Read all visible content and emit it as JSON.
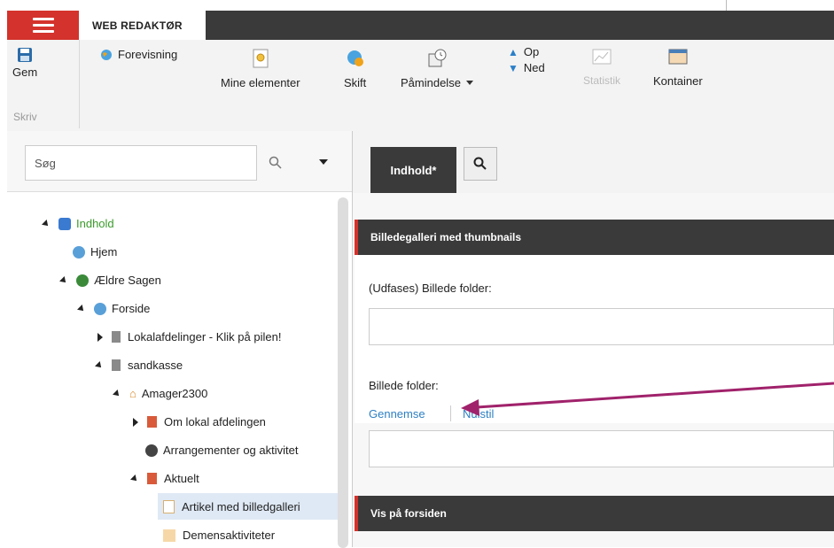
{
  "topbar": {
    "tab_label": "WEB REDAKTØR"
  },
  "ribbon": {
    "save_label": "Gem",
    "write_label": "Skriv",
    "preview_label": "Forevisning",
    "my_elements_label": "Mine elementer",
    "switch_label": "Skift",
    "reminder_label": "Påmindelse",
    "up_label": "Op",
    "down_label": "Ned",
    "statistics_label": "Statistik",
    "container_label": "Kontainer"
  },
  "search": {
    "placeholder": "Søg"
  },
  "tree": {
    "items": [
      {
        "label": "Indhold"
      },
      {
        "label": "Hjem"
      },
      {
        "label": "Ældre Sagen"
      },
      {
        "label": "Forside"
      },
      {
        "label": "Lokalafdelinger - Klik på pilen!"
      },
      {
        "label": "sandkasse"
      },
      {
        "label": "Amager2300"
      },
      {
        "label": "Om lokal afdelingen"
      },
      {
        "label": "Arrangementer og aktivitet"
      },
      {
        "label": "Aktuelt"
      },
      {
        "label": "Artikel med billedgalleri"
      },
      {
        "label": "Demensaktiviteter"
      }
    ]
  },
  "content_tabs": {
    "active_label": "Indhold*"
  },
  "section1": {
    "title": "Billedegalleri med thumbnails",
    "field1_label": "(Udfases) Billede folder:",
    "field2_label": "Billede folder:",
    "browse_link": "Gennemse",
    "clear_link": "Nulstil"
  },
  "section2": {
    "title": "Vis på forsiden"
  },
  "colors": {
    "accent": "#d4322c",
    "dark": "#3a3a3a",
    "link": "#2d7fc3",
    "annotation_arrow": "#a0226b"
  }
}
